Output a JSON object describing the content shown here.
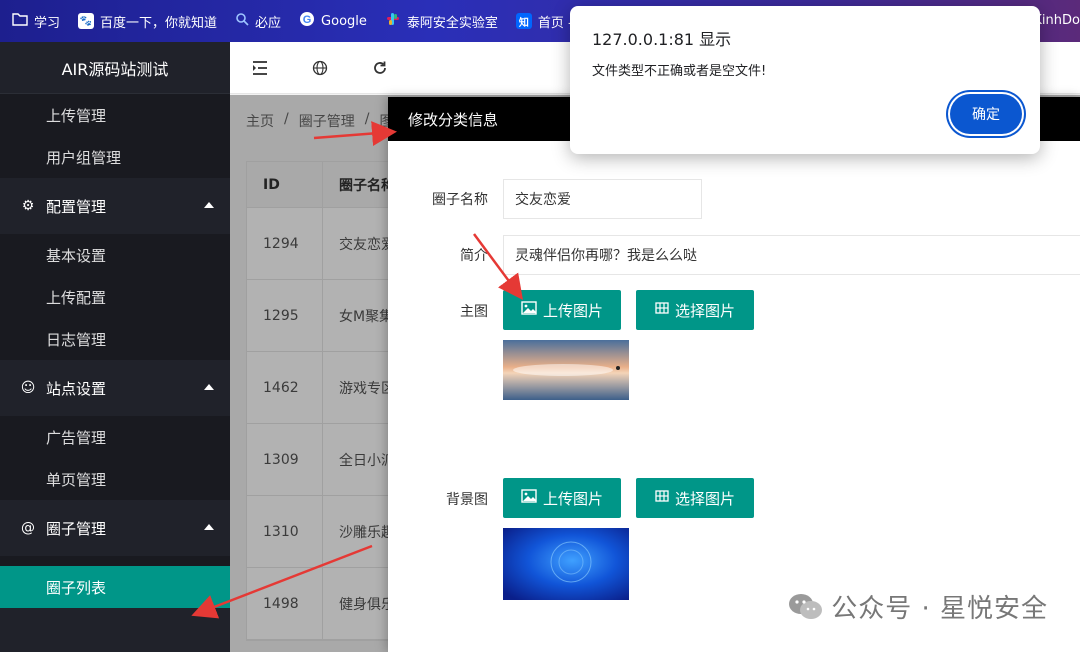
{
  "bookmarks": [
    {
      "label": "学习",
      "icon": "folder-icon",
      "color": "#ffffff"
    },
    {
      "label": "百度一下，你就知道",
      "icon": "baidu-icon",
      "color": "#2932e1"
    },
    {
      "label": "必应",
      "icon": "search-icon",
      "color": "#ffffff"
    },
    {
      "label": "Google",
      "icon": "google-icon",
      "color": "#ffffff"
    },
    {
      "label": "泰阿安全实验室",
      "icon": "slack-icon",
      "color": "#ffffff"
    },
    {
      "label": "首页 -",
      "icon": "zhihu-icon",
      "color": "#0066ff"
    }
  ],
  "bookmarks_right": "KinhDo",
  "sidebar": {
    "brand": "AIR源码站测试",
    "items_top": [
      "上传管理",
      "用户组管理"
    ],
    "group_config": "配置管理",
    "items_config": [
      "基本设置",
      "上传配置",
      "日志管理"
    ],
    "group_site": "站点设置",
    "items_site": [
      "广告管理",
      "单页管理"
    ],
    "group_circle": "圈子管理",
    "active_item": "圈子列表"
  },
  "breadcrumb": [
    "主页",
    "/",
    "圈子管理",
    "/",
    "图"
  ],
  "table": {
    "headers": [
      "ID",
      "圈子名称"
    ],
    "rows": [
      {
        "id": "1294",
        "name": "交友恋爱"
      },
      {
        "id": "1295",
        "name": "女M聚集"
      },
      {
        "id": "1462",
        "name": "游戏专区"
      },
      {
        "id": "1309",
        "name": "全日小派"
      },
      {
        "id": "1310",
        "name": "沙雕乐趣"
      },
      {
        "id": "1498",
        "name": "健身俱乐"
      }
    ]
  },
  "modal": {
    "title": "修改分类信息",
    "name_label": "圈子名称",
    "name_value": "交友恋爱",
    "intro_label": "简介",
    "intro_value": "灵魂伴侣你再哪？我是么么哒",
    "main_label": "主图",
    "bg_label": "背景图",
    "upload_label": "上传图片",
    "select_label": "选择图片"
  },
  "alert": {
    "title": "127.0.0.1:81 显示",
    "message": "文件类型不正确或者是空文件!",
    "ok": "确定"
  },
  "watermark": "公众号 · 星悦安全",
  "colors": {
    "accent": "#009688",
    "sidebar": "#20222a",
    "alert_button": "#0b57d0",
    "arrow": "#e53935"
  }
}
